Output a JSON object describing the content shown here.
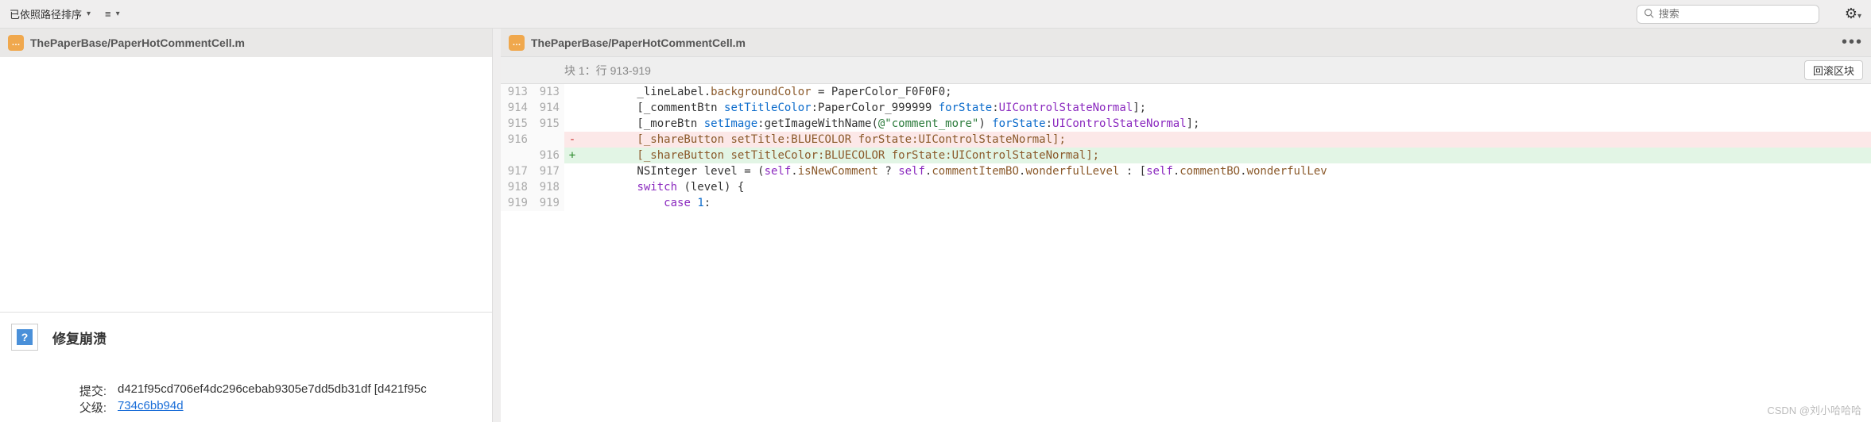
{
  "toolbar": {
    "sort_label": "已依照路径排序",
    "search_placeholder": "搜索"
  },
  "left": {
    "file_name": "ThePaperBase/PaperHotCommentCell.m",
    "commit_message": "修复崩溃",
    "commit_label": "提交:",
    "commit_hash": "d421f95cd706ef4dc296cebab9305e7dd5db31df [d421f95c",
    "parent_label": "父级:",
    "parent_hash": "734c6bb94d"
  },
  "right": {
    "file_name": "ThePaperBase/PaperHotCommentCell.m",
    "hunk_label": "块 1：行 913-919",
    "rollback_label": "回滚区块"
  },
  "diff": [
    {
      "old": "913",
      "new": "913",
      "m": " ",
      "segs": [
        {
          "t": "        _lineLabel."
        },
        {
          "t": "backgroundColor",
          "c": "t-brown"
        },
        {
          "t": " = PaperColor_F0F0F0;"
        }
      ]
    },
    {
      "old": "914",
      "new": "914",
      "m": " ",
      "segs": [
        {
          "t": "        [_commentBtn "
        },
        {
          "t": "setTitleColor",
          "c": "t-blue"
        },
        {
          "t": ":PaperColor_999999 "
        },
        {
          "t": "forState",
          "c": "t-blue"
        },
        {
          "t": ":"
        },
        {
          "t": "UIControlStateNormal",
          "c": "t-purple"
        },
        {
          "t": "];"
        }
      ]
    },
    {
      "old": "915",
      "new": "915",
      "m": " ",
      "segs": [
        {
          "t": "        [_moreBtn "
        },
        {
          "t": "setImage",
          "c": "t-blue"
        },
        {
          "t": ":getImageWithName("
        },
        {
          "t": "@\"comment_more\"",
          "c": "t-green"
        },
        {
          "t": ") "
        },
        {
          "t": "forState",
          "c": "t-blue"
        },
        {
          "t": ":"
        },
        {
          "t": "UIControlStateNormal",
          "c": "t-purple"
        },
        {
          "t": "];"
        }
      ]
    },
    {
      "old": "916",
      "new": "",
      "m": "-",
      "cls": "row-del",
      "segs": [
        {
          "t": "        [_shareButton ",
          "c": "t-brown"
        },
        {
          "t": "setTitle",
          "c": "t-brown"
        },
        {
          "t": ":BLUECOLOR ",
          "c": "t-brown"
        },
        {
          "t": "forState",
          "c": "t-brown"
        },
        {
          "t": ":",
          "c": "t-brown"
        },
        {
          "t": "UIControlStateNormal",
          "c": "t-brown"
        },
        {
          "t": "];",
          "c": "t-brown"
        }
      ]
    },
    {
      "old": "",
      "new": "916",
      "m": "+",
      "cls": "row-add",
      "segs": [
        {
          "t": "        [_shareButton ",
          "c": "t-brown"
        },
        {
          "t": "setTitleColor",
          "c": "t-brown"
        },
        {
          "t": ":BLUECOLOR ",
          "c": "t-brown"
        },
        {
          "t": "forState",
          "c": "t-brown"
        },
        {
          "t": ":",
          "c": "t-brown"
        },
        {
          "t": "UIControlStateNormal",
          "c": "t-brown"
        },
        {
          "t": "];",
          "c": "t-brown"
        }
      ]
    },
    {
      "old": "917",
      "new": "917",
      "m": " ",
      "segs": [
        {
          "t": "        NSInteger level = ("
        },
        {
          "t": "self",
          "c": "t-purple"
        },
        {
          "t": "."
        },
        {
          "t": "isNewComment",
          "c": "t-brown"
        },
        {
          "t": " ? "
        },
        {
          "t": "self",
          "c": "t-purple"
        },
        {
          "t": "."
        },
        {
          "t": "commentItemBO",
          "c": "t-brown"
        },
        {
          "t": "."
        },
        {
          "t": "wonderfulLevel",
          "c": "t-brown"
        },
        {
          "t": " : ["
        },
        {
          "t": "self",
          "c": "t-purple"
        },
        {
          "t": "."
        },
        {
          "t": "commentBO",
          "c": "t-brown"
        },
        {
          "t": "."
        },
        {
          "t": "wonderfulLev",
          "c": "t-brown"
        }
      ]
    },
    {
      "old": "918",
      "new": "918",
      "m": " ",
      "segs": [
        {
          "t": "        "
        },
        {
          "t": "switch",
          "c": "t-purple"
        },
        {
          "t": " (level) {"
        }
      ]
    },
    {
      "old": "919",
      "new": "919",
      "m": " ",
      "segs": [
        {
          "t": "            "
        },
        {
          "t": "case",
          "c": "t-purple"
        },
        {
          "t": " "
        },
        {
          "t": "1",
          "c": "t-blue"
        },
        {
          "t": ":"
        }
      ]
    }
  ],
  "watermark": "CSDN @刘小哈哈哈"
}
